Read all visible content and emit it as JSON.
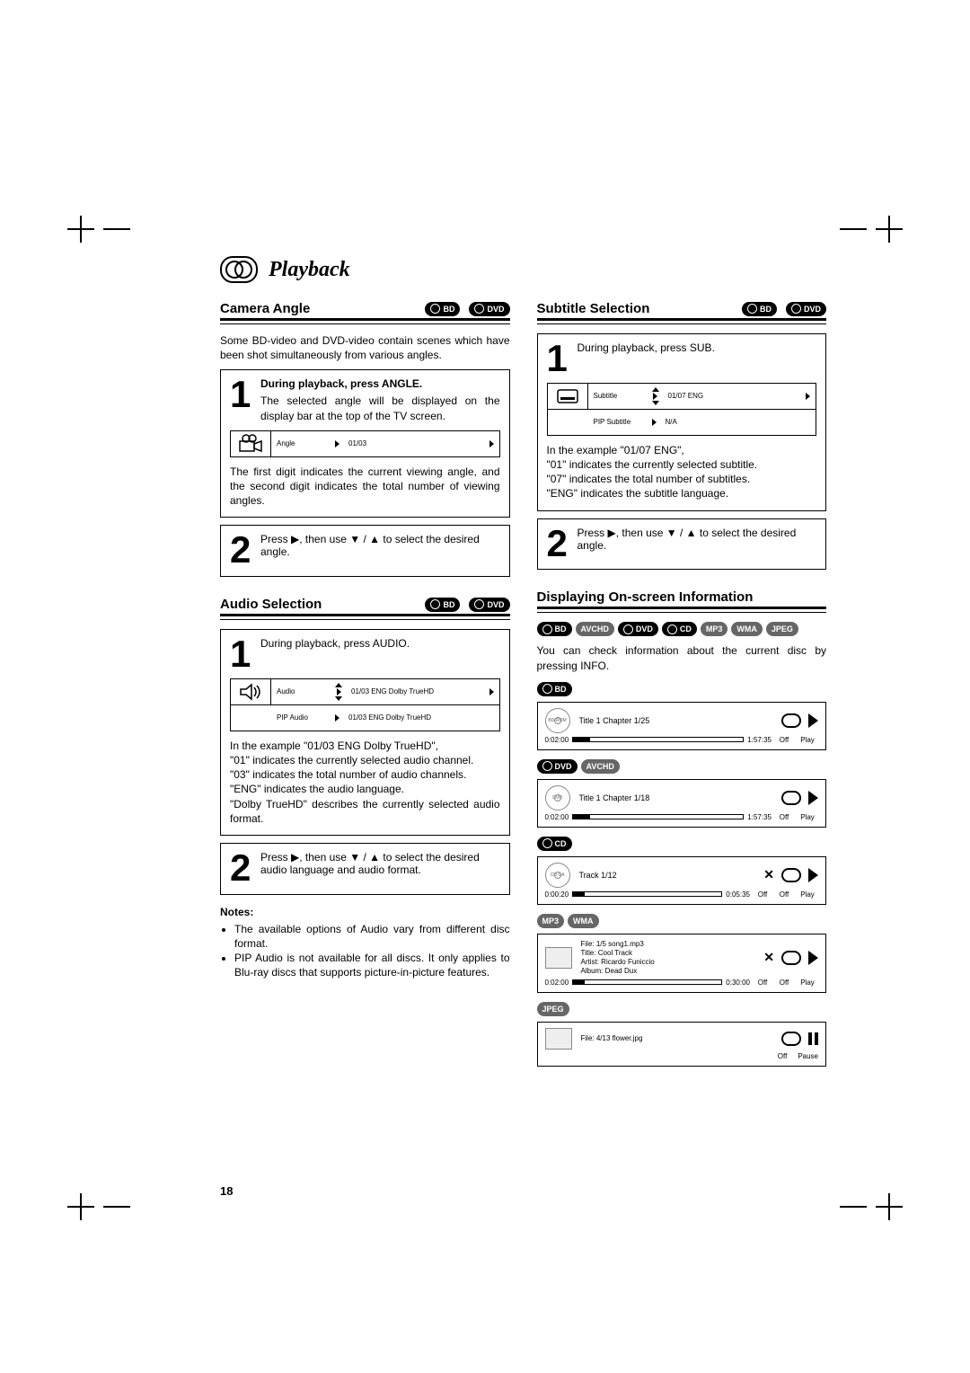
{
  "page_number": "18",
  "heading": "Playback",
  "left": {
    "camera": {
      "title": "Camera Angle",
      "badges": [
        "BD",
        "DVD"
      ],
      "intro": "Some BD-video and DVD-video contain scenes which have been shot simultaneously from various angles.",
      "step1": {
        "bold": "During playback, press ANGLE.",
        "text": "The selected angle will be displayed on the display bar at the top of the TV screen.",
        "osd_label": "Angle",
        "osd_value": "01/03",
        "after": "The first digit indicates the current viewing angle, and the second digit indicates the total number of viewing angles."
      },
      "step2": {
        "bold": "Press ▶, then use ▼ / ▲ to select the desired angle."
      }
    },
    "audio": {
      "title": "Audio Selection",
      "badges": [
        "BD",
        "DVD"
      ],
      "step1": {
        "bold": "During playback, press AUDIO.",
        "row1_label": "Audio",
        "row1_value": "01/03 ENG Dolby TrueHD",
        "row2_label": "PIP Audio",
        "row2_value": "01/03 ENG Dolby TrueHD",
        "para1": "In the example \"01/03 ENG Dolby TrueHD\",",
        "para2": "\"01\" indicates the currently selected audio channel.",
        "para3": "\"03\" indicates the total number of audio channels.",
        "para4": "\"ENG\" indicates the audio language.",
        "para5": "\"Dolby TrueHD\" describes the currently selected audio format."
      },
      "step2": {
        "bold": "Press ▶, then use ▼ / ▲ to select the desired audio language and audio format."
      },
      "notes_h": "Notes:",
      "notes": [
        "The available options of Audio vary from different disc format.",
        "PIP Audio is not available for all discs. It only applies to Blu-ray discs that supports picture-in-picture features."
      ]
    }
  },
  "right": {
    "subtitle": {
      "title": "Subtitle Selection",
      "badges": [
        "BD",
        "DVD"
      ],
      "step1": {
        "bold": "During playback, press SUB.",
        "row1_label": "Subtitle",
        "row1_value": "01/07 ENG",
        "row2_label": "PIP Subtitle",
        "row2_value": "N/A",
        "para1": "In the example \"01/07 ENG\",",
        "para2": "\"01\" indicates the currently selected subtitle.",
        "para3": "\"07\" indicates the total number of subtitles.",
        "para4": "\"ENG\" indicates the subtitle language."
      },
      "step2": {
        "bold": "Press ▶, then use ▼ / ▲ to select the desired angle."
      }
    },
    "onscreen": {
      "title": "Displaying On-screen Information",
      "badges": [
        "BD",
        "AVCHD",
        "DVD",
        "CD",
        "MP3",
        "WMA",
        "JPEG"
      ],
      "intro": "You can check information about the current disc by pressing INFO.",
      "bd": {
        "badge": "BD",
        "disc_label": "BD-ROM",
        "title_line": "Title 1 Chapter 1/25",
        "t_cur": "0:02:00",
        "t_total": "1:57:35",
        "s1": "Off",
        "s2": "Play"
      },
      "dvd": {
        "badges": [
          "DVD",
          "AVCHD"
        ],
        "disc_label": "DVD",
        "title_line": "Title 1 Chapter 1/18",
        "t_cur": "0:02:00",
        "t_total": "1:57:35",
        "s1": "Off",
        "s2": "Play"
      },
      "cd": {
        "badge": "CD",
        "disc_label": "CD-DA",
        "title_line": "Track 1/12",
        "t_cur": "0:00:20",
        "t_total": "0:05:35",
        "s1": "Off",
        "s2": "Off",
        "s3": "Play"
      },
      "mp3": {
        "badges": [
          "MP3",
          "WMA"
        ],
        "file": "File: 1/5  song1.mp3",
        "title": "Title: Cool Track",
        "artist": "Artist: Ricardo Funiccio",
        "album": "Album: Dead Dux",
        "t_cur": "0:02:00",
        "t_total": "0:30:00",
        "s1": "Off",
        "s2": "Off",
        "s3": "Play"
      },
      "jpeg": {
        "badge": "JPEG",
        "file": "File: 4/13  flower.jpg",
        "s1": "Off",
        "s2": "Pause"
      }
    }
  }
}
